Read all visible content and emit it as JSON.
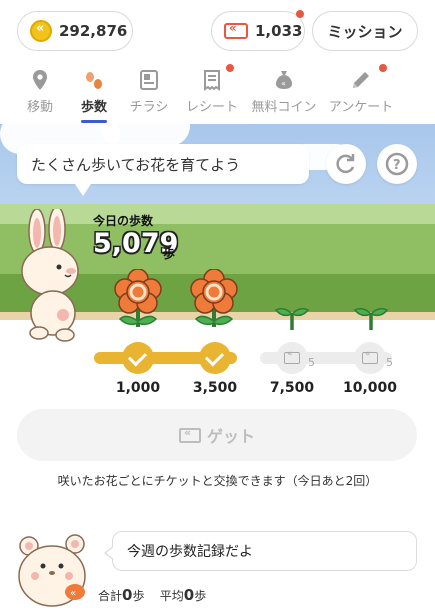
{
  "header": {
    "points": "292,876",
    "tickets": "1,033",
    "mission_label": "ミッション"
  },
  "tabs": [
    {
      "label": "移動",
      "icon": "location-pin-icon"
    },
    {
      "label": "歩数",
      "icon": "footprints-icon"
    },
    {
      "label": "チラシ",
      "icon": "flyer-icon"
    },
    {
      "label": "レシート",
      "icon": "receipt-icon"
    },
    {
      "label": "無料コイン",
      "icon": "coin-bag-icon"
    },
    {
      "label": "アンケート",
      "icon": "pencil-icon"
    }
  ],
  "active_tab": "歩数",
  "scene": {
    "bubble_text": "たくさん歩いてお花を育てよう",
    "steps_caption": "今日の歩数",
    "steps_count": "5,079",
    "steps_unit": "歩"
  },
  "progress": {
    "fraction": 0.48,
    "milestones": [
      {
        "label": "1,000",
        "state": "done"
      },
      {
        "label": "3,500",
        "state": "done"
      },
      {
        "label": "7,500",
        "state": "locked",
        "ticket_count": "5"
      },
      {
        "label": "10,000",
        "state": "locked",
        "ticket_count": "5"
      }
    ]
  },
  "get_button_label": "ゲット",
  "note": "咲いたお花ごとにチケットと交換できます（今日あと2回）",
  "weekly": {
    "bubble_text": "今週の歩数記録だよ",
    "total_label": "合計",
    "total_value": "0",
    "avg_label": "平均",
    "avg_value": "0",
    "unit": "歩"
  },
  "colors": {
    "accent_gold": "#e8b432",
    "flower_orange": "#f07a3a",
    "tab_underline": "#3b5bd6",
    "notification_dot": "#e9573f"
  }
}
